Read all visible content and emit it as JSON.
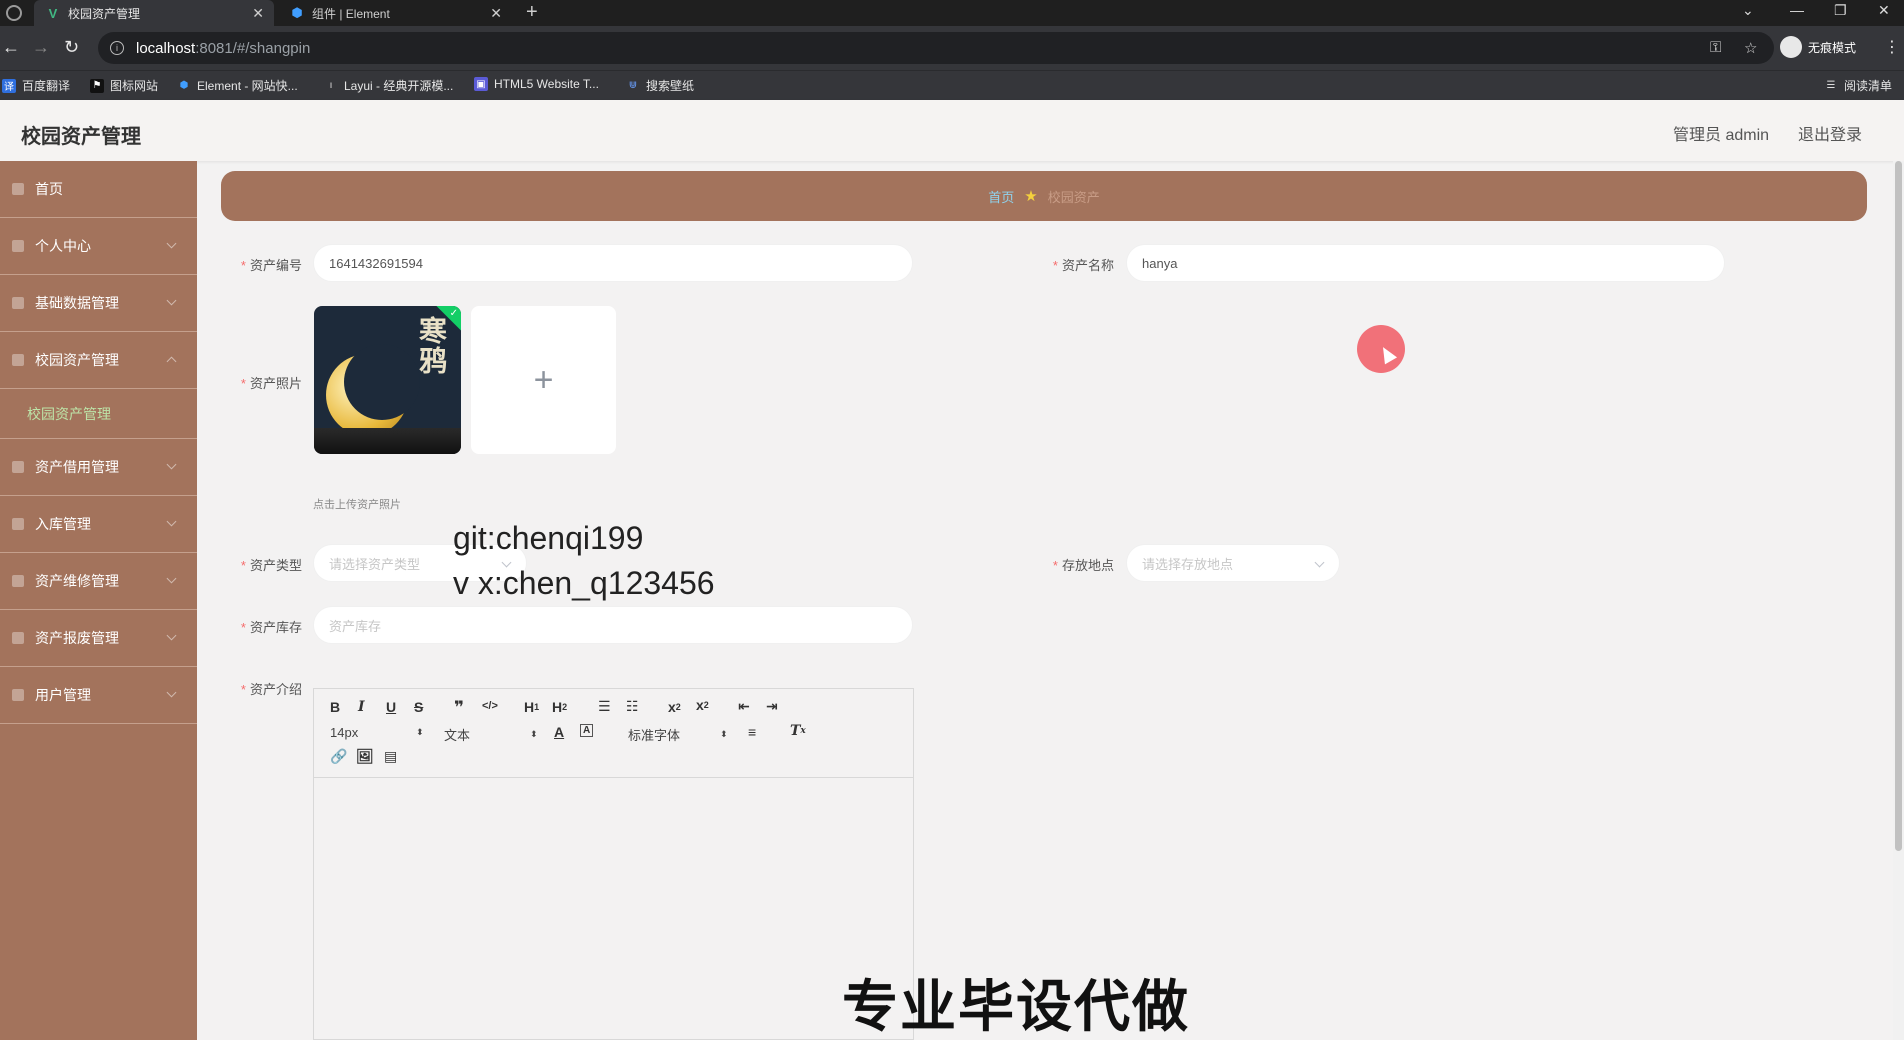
{
  "browser": {
    "tabs": [
      {
        "title": "校园资产管理",
        "active": true
      },
      {
        "title": "组件 | Element",
        "active": false
      }
    ],
    "url_host": "localhost",
    "url_path": ":8081/#/shangpin",
    "incognito_label": "无痕模式",
    "bookmarks": [
      "百度翻译",
      "图标网站",
      "Element - 网站快...",
      "Layui - 经典开源模...",
      "HTML5 Website T...",
      "搜索壁纸"
    ],
    "reading_list": "阅读清单"
  },
  "header": {
    "title": "校园资产管理",
    "admin": "管理员 admin",
    "logout": "退出登录"
  },
  "sidebar": {
    "items": [
      {
        "label": "首页"
      },
      {
        "label": "个人中心"
      },
      {
        "label": "基础数据管理"
      },
      {
        "label": "校园资产管理"
      },
      {
        "label": "校园资产管理",
        "sub": true
      },
      {
        "label": "资产借用管理"
      },
      {
        "label": "入库管理"
      },
      {
        "label": "资产维修管理"
      },
      {
        "label": "资产报废管理"
      },
      {
        "label": "用户管理"
      }
    ]
  },
  "breadcrumb": {
    "home": "首页",
    "current": "校园资产"
  },
  "form": {
    "asset_no_label": "资产编号",
    "asset_no_value": "1641432691594",
    "asset_name_label": "资产名称",
    "asset_name_value": "hanya",
    "photo_label": "资产照片",
    "photo_title": "寒鸦",
    "upload_hint": "点击上传资产照片",
    "type_label": "资产类型",
    "type_placeholder": "请选择资产类型",
    "location_label": "存放地点",
    "location_placeholder": "请选择存放地点",
    "stock_label": "资产库存",
    "stock_placeholder": "资产库存",
    "intro_label": "资产介绍"
  },
  "editor": {
    "font_size": "14px",
    "text_type": "文本",
    "font_family": "标准字体"
  },
  "overlay": {
    "line1": "git:chenqi199",
    "line2": "v x:chen_q123456",
    "banner": "专业毕设代做"
  },
  "colors": {
    "sidebar": "#a3735c",
    "active_sub": "#bde4a8",
    "required": "#f56c6c",
    "breadcrumb_home": "#8fd3ee"
  }
}
